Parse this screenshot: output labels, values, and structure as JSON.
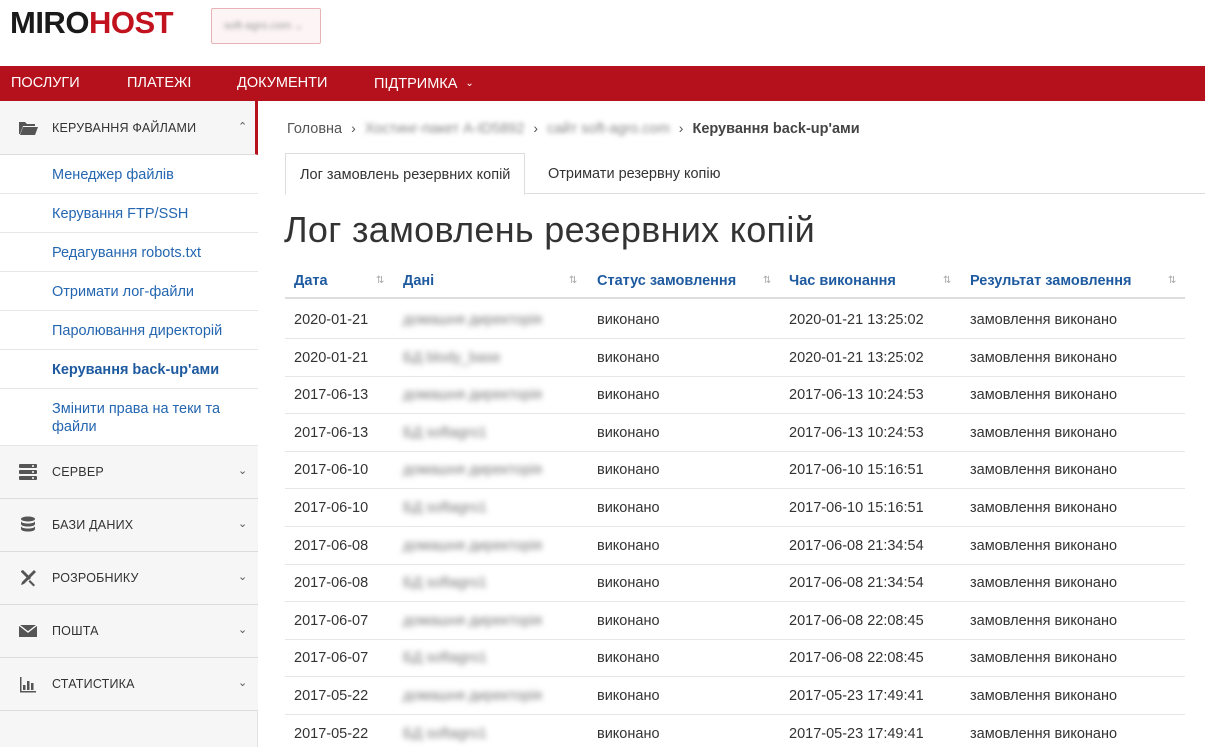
{
  "brand": {
    "part1": "MIRO",
    "part2": "HOST"
  },
  "domain_selector": {
    "value": "soft-agro.com ⌄"
  },
  "nav": {
    "items": [
      {
        "label": "ПОСЛУГИ"
      },
      {
        "label": "ПЛАТЕЖІ"
      },
      {
        "label": "ДОКУМЕНТИ"
      },
      {
        "label": "ПІДТРИМКА",
        "chevron": "⌄"
      }
    ]
  },
  "sidebar": {
    "files_section": {
      "label": "КЕРУВАННЯ ФАЙЛАМИ",
      "icon": "folder-open-icon",
      "chevron": "⌃"
    },
    "sub_items": [
      {
        "label": "Менеджер файлів"
      },
      {
        "label": "Керування FTP/SSH"
      },
      {
        "label": "Редагування robots.txt"
      },
      {
        "label": "Отримати лог-файли"
      },
      {
        "label": "Паролювання директорій"
      },
      {
        "label": "Керування back-up'ами"
      },
      {
        "label": "Змінити права на теки та файли"
      }
    ],
    "sections": [
      {
        "label": "СЕРВЕР",
        "icon": "server-icon",
        "chevron": "⌄"
      },
      {
        "label": "БАЗИ ДАНИХ",
        "icon": "database-icon",
        "chevron": "⌄"
      },
      {
        "label": "РОЗРОБНИКУ",
        "icon": "tools-icon",
        "chevron": "⌄"
      },
      {
        "label": "ПОШТА",
        "icon": "mail-icon",
        "chevron": "⌄"
      },
      {
        "label": "СТАТИСТИКА",
        "icon": "chart-icon",
        "chevron": "⌄"
      }
    ]
  },
  "breadcrumb": {
    "home": "Головна",
    "sep": "›",
    "hosting": "Хостинг-пакет А-ID5892",
    "site": "сайт soft-agro.com",
    "current": "Керування back-up'ами"
  },
  "tabs": [
    {
      "label": "Лог замовлень резервних копій"
    },
    {
      "label": "Отримати резервну копію"
    }
  ],
  "page_title": "Лог замовлень резервних копій",
  "table": {
    "sort_icon": "⇅",
    "columns": [
      {
        "label": "Дата"
      },
      {
        "label": "Дані"
      },
      {
        "label": "Статус замовлення"
      },
      {
        "label": "Час виконання"
      },
      {
        "label": "Результат замовлення"
      }
    ],
    "rows": [
      {
        "date": "2020-01-21",
        "data": "домашня директорія",
        "status": "виконано",
        "time": "2020-01-21 13:25:02",
        "result": "замовлення виконано"
      },
      {
        "date": "2020-01-21",
        "data": "БД blody_base",
        "status": "виконано",
        "time": "2020-01-21 13:25:02",
        "result": "замовлення виконано"
      },
      {
        "date": "2017-06-13",
        "data": "домашня директорія",
        "status": "виконано",
        "time": "2017-06-13 10:24:53",
        "result": "замовлення виконано"
      },
      {
        "date": "2017-06-13",
        "data": "БД softagro1",
        "status": "виконано",
        "time": "2017-06-13 10:24:53",
        "result": "замовлення виконано"
      },
      {
        "date": "2017-06-10",
        "data": "домашня директорія",
        "status": "виконано",
        "time": "2017-06-10 15:16:51",
        "result": "замовлення виконано"
      },
      {
        "date": "2017-06-10",
        "data": "БД softagro1",
        "status": "виконано",
        "time": "2017-06-10 15:16:51",
        "result": "замовлення виконано"
      },
      {
        "date": "2017-06-08",
        "data": "домашня директорія",
        "status": "виконано",
        "time": "2017-06-08 21:34:54",
        "result": "замовлення виконано"
      },
      {
        "date": "2017-06-08",
        "data": "БД softagro1",
        "status": "виконано",
        "time": "2017-06-08 21:34:54",
        "result": "замовлення виконано"
      },
      {
        "date": "2017-06-07",
        "data": "домашня директорія",
        "status": "виконано",
        "time": "2017-06-08 22:08:45",
        "result": "замовлення виконано"
      },
      {
        "date": "2017-06-07",
        "data": "БД softagro1",
        "status": "виконано",
        "time": "2017-06-08 22:08:45",
        "result": "замовлення виконано"
      },
      {
        "date": "2017-05-22",
        "data": "домашня директорія",
        "status": "виконано",
        "time": "2017-05-23 17:49:41",
        "result": "замовлення виконано"
      },
      {
        "date": "2017-05-22",
        "data": "БД softagro1",
        "status": "виконано",
        "time": "2017-05-23 17:49:41",
        "result": "замовлення виконано"
      }
    ]
  },
  "colors": {
    "brand_red": "#b5111c",
    "link_blue": "#2466b0"
  }
}
